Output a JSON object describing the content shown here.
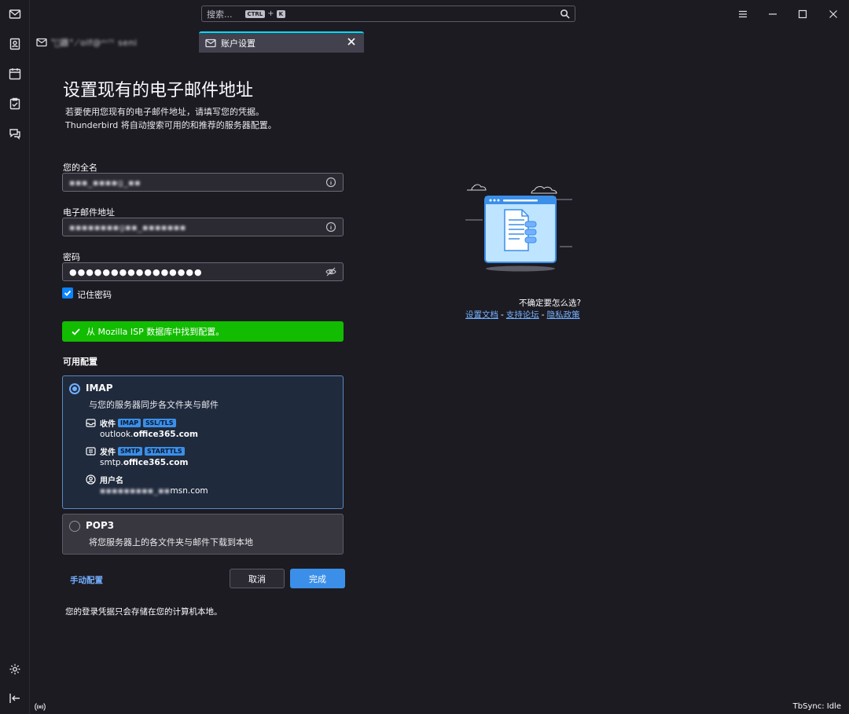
{
  "titlebar": {
    "search_placeholder": "搜索...",
    "shortcut_ctrl": "CTRL",
    "shortcut_plus": "+",
    "shortcut_key": "K"
  },
  "tabs": [
    {
      "label": "ʻ̂ﾞ䶆°⟋olf@ᵒᶜᶠᵗ seni",
      "icon": "mail-icon"
    },
    {
      "label": "账户设置",
      "icon": "account-settings-icon"
    }
  ],
  "page": {
    "title": "设置现有的电子邮件地址",
    "subtitle_line1": "若要使用您现有的电子邮件地址，请填写您的凭据。",
    "subtitle_line2": "Thunderbird 将自动搜索可用的和推荐的服务器配置。"
  },
  "form": {
    "fullname_label": "您的全名",
    "fullname_value": "▪▪▪_▪▪▪▪g_▪▪",
    "email_label": "电子邮件地址",
    "email_value": "▪▪▪▪▪▪▪▪g▪▪_▪▪▪▪▪▪▪",
    "password_label": "密码",
    "password_value": "●●●●●●●●●●●●●●●●",
    "remember_label": "记住密码",
    "remember_checked": true
  },
  "status": {
    "success_message": "从 Mozilla ISP 数据库中找到配置。",
    "success_color": "#12bc00"
  },
  "configs": {
    "section_title": "可用配置",
    "imap": {
      "title": "IMAP",
      "desc": "与您的服务器同步各文件夹与邮件",
      "incoming_label": "收件",
      "incoming_badges": [
        "IMAP",
        "SSL/TLS"
      ],
      "incoming_host_prefix": "outlook.",
      "incoming_host_bold": "office365.com",
      "outgoing_label": "发件",
      "outgoing_badges": [
        "SMTP",
        "STARTTLS"
      ],
      "outgoing_host_prefix": "smtp.",
      "outgoing_host_bold": "office365.com",
      "username_label": "用户名",
      "username_value_blur": "▪▪▪▪▪▪▪▪▪_▪▪",
      "username_value_suffix": "msn.com"
    },
    "pop3": {
      "title": "POP3",
      "desc": "将您服务器上的各文件夹与邮件下载到本地"
    }
  },
  "actions": {
    "manual_config": "手动配置",
    "cancel": "取消",
    "done": "完成"
  },
  "footer_note": "您的登录凭据只会存储在您的计算机本地。",
  "help": {
    "question": "不确定要怎么选?",
    "link_docs": "设置文档",
    "link_forum": "支持论坛",
    "link_privacy": "隐私政策",
    "separator": "-"
  },
  "statusbar": {
    "text": "TbSync: Idle"
  }
}
